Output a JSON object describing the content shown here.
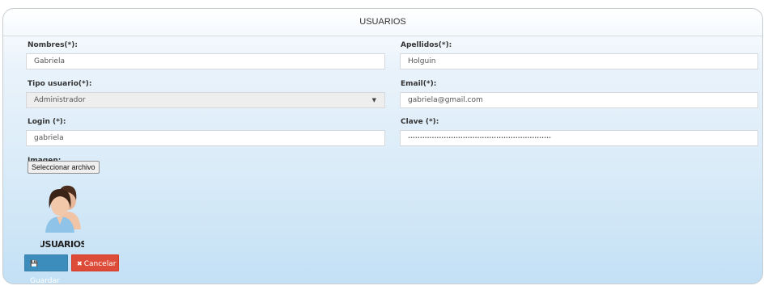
{
  "panel": {
    "title": "USUARIOS"
  },
  "form": {
    "nombres": {
      "label": "Nombres(*):",
      "value": "Gabriela"
    },
    "apellidos": {
      "label": "Apellidos(*):",
      "value": "Holguin"
    },
    "tipo_usuario": {
      "label": "Tipo usuario(*):",
      "value": "Administrador"
    },
    "email": {
      "label": "Email(*):",
      "value": "gabriela@gmail.com"
    },
    "login": {
      "label": "Login (*):",
      "value": "gabriela"
    },
    "clave": {
      "label": "Clave (*):",
      "value": "••••••••••••••••••••••••••••••••••••••••••••••••••••••••••••"
    },
    "imagen": {
      "label": "Imagen:",
      "file_button": "Seleccionar archivo",
      "image_caption": "USUARIOS"
    }
  },
  "actions": {
    "save_label": "Guardar",
    "cancel_label": "Cancelar"
  },
  "icons": {
    "save": "floppy-disk-icon",
    "cancel": "x-circle-icon",
    "dropdown": "caret-down-icon"
  },
  "colors": {
    "save": "#3c8dbc",
    "cancel": "#dd4b39"
  }
}
